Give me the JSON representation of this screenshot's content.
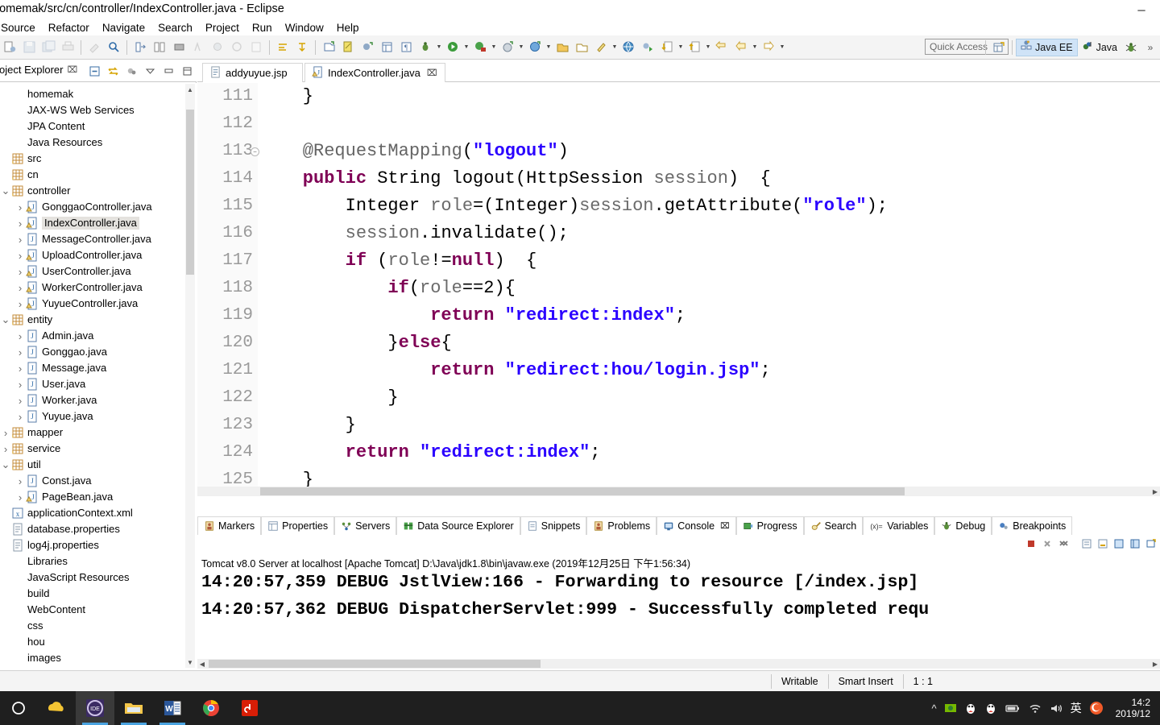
{
  "window": {
    "title": "homemak/src/cn/controller/IndexController.java - Eclipse",
    "minimize": "─",
    "maximize": "❐",
    "close": "✕"
  },
  "menubar": {
    "items": [
      "Source",
      "Refactor",
      "Navigate",
      "Search",
      "Project",
      "Run",
      "Window",
      "Help"
    ]
  },
  "toolbar": {
    "quick_access_placeholder": "Quick Access",
    "perspectives": [
      {
        "label": "Java EE",
        "active": true,
        "icon": "java-ee-perspective-icon"
      },
      {
        "label": "Java",
        "active": false,
        "icon": "java-perspective-icon"
      }
    ],
    "open_perspective_icon": "open-perspective-icon",
    "debug_perspective_icon": "debug-perspective-icon"
  },
  "explorer": {
    "tab_label": "Project Explorer",
    "tab_close": "⌧",
    "tools": [
      "collapse-all-icon",
      "link-with-editor-icon",
      "view-menu-icon",
      "minimize-icon",
      "maximize-icon"
    ],
    "tree": [
      {
        "label": "homemak",
        "indent": 0,
        "arrow": "",
        "icon": "project-icon",
        "selected": false
      },
      {
        "label": "JAX-WS Web Services",
        "indent": 0,
        "arrow": "",
        "icon": "folder-icon",
        "selected": false
      },
      {
        "label": "JPA Content",
        "indent": 0,
        "arrow": "",
        "icon": "folder-icon",
        "selected": false
      },
      {
        "label": "Java Resources",
        "indent": 0,
        "arrow": "",
        "icon": "folder-icon",
        "selected": false
      },
      {
        "label": "src",
        "indent": 0,
        "arrow": "",
        "icon": "source-folder-icon",
        "selected": false
      },
      {
        "label": "cn",
        "indent": 0,
        "arrow": "",
        "icon": "package-icon",
        "selected": false
      },
      {
        "label": "controller",
        "indent": 1,
        "arrow": "∨",
        "icon": "package-icon",
        "selected": false
      },
      {
        "label": "GonggaoController.java",
        "indent": 2,
        "arrow": "›",
        "icon": "java-warning-file-icon",
        "selected": false
      },
      {
        "label": "IndexController.java",
        "indent": 2,
        "arrow": "›",
        "icon": "java-warning-file-icon",
        "selected": true
      },
      {
        "label": "MessageController.java",
        "indent": 2,
        "arrow": "›",
        "icon": "java-file-icon",
        "selected": false
      },
      {
        "label": "UploadController.java",
        "indent": 2,
        "arrow": "›",
        "icon": "java-warning-file-icon",
        "selected": false
      },
      {
        "label": "UserController.java",
        "indent": 2,
        "arrow": "›",
        "icon": "java-warning-file-icon",
        "selected": false
      },
      {
        "label": "WorkerController.java",
        "indent": 2,
        "arrow": "›",
        "icon": "java-warning-file-icon",
        "selected": false
      },
      {
        "label": "YuyueController.java",
        "indent": 2,
        "arrow": "›",
        "icon": "java-warning-file-icon",
        "selected": false
      },
      {
        "label": "entity",
        "indent": 1,
        "arrow": "∨",
        "icon": "package-icon",
        "selected": false
      },
      {
        "label": "Admin.java",
        "indent": 2,
        "arrow": "›",
        "icon": "java-file-icon",
        "selected": false
      },
      {
        "label": "Gonggao.java",
        "indent": 2,
        "arrow": "›",
        "icon": "java-file-icon",
        "selected": false
      },
      {
        "label": "Message.java",
        "indent": 2,
        "arrow": "›",
        "icon": "java-file-icon",
        "selected": false
      },
      {
        "label": "User.java",
        "indent": 2,
        "arrow": "›",
        "icon": "java-file-icon",
        "selected": false
      },
      {
        "label": "Worker.java",
        "indent": 2,
        "arrow": "›",
        "icon": "java-file-icon",
        "selected": false
      },
      {
        "label": "Yuyue.java",
        "indent": 2,
        "arrow": "›",
        "icon": "java-file-icon",
        "selected": false
      },
      {
        "label": "mapper",
        "indent": 1,
        "arrow": "›",
        "icon": "package-icon",
        "selected": false
      },
      {
        "label": "service",
        "indent": 1,
        "arrow": "›",
        "icon": "package-icon",
        "selected": false
      },
      {
        "label": "util",
        "indent": 1,
        "arrow": "∨",
        "icon": "package-icon",
        "selected": false
      },
      {
        "label": "Const.java",
        "indent": 2,
        "arrow": "›",
        "icon": "java-file-icon",
        "selected": false
      },
      {
        "label": "PageBean.java",
        "indent": 2,
        "arrow": "›",
        "icon": "java-warning-file-icon",
        "selected": false
      },
      {
        "label": "applicationContext.xml",
        "indent": 0,
        "arrow": "",
        "icon": "xml-file-icon",
        "selected": false
      },
      {
        "label": "database.properties",
        "indent": 0,
        "arrow": "",
        "icon": "properties-file-icon",
        "selected": false
      },
      {
        "label": "log4j.properties",
        "indent": 0,
        "arrow": "",
        "icon": "properties-file-icon",
        "selected": false
      },
      {
        "label": "Libraries",
        "indent": 0,
        "arrow": "",
        "icon": "library-icon",
        "selected": false
      },
      {
        "label": "JavaScript Resources",
        "indent": 0,
        "arrow": "",
        "icon": "library-icon",
        "selected": false
      },
      {
        "label": "build",
        "indent": 0,
        "arrow": "",
        "icon": "folder-icon",
        "selected": false
      },
      {
        "label": "WebContent",
        "indent": 0,
        "arrow": "",
        "icon": "folder-icon",
        "selected": false
      },
      {
        "label": "css",
        "indent": 0,
        "arrow": "",
        "icon": "folder-icon",
        "selected": false
      },
      {
        "label": "hou",
        "indent": 0,
        "arrow": "",
        "icon": "folder-icon",
        "selected": false
      },
      {
        "label": "images",
        "indent": 0,
        "arrow": "",
        "icon": "folder-icon",
        "selected": false
      }
    ]
  },
  "editor": {
    "tabs": [
      {
        "label": "addyuyue.jsp",
        "active": false,
        "icon": "jsp-file-icon",
        "close": ""
      },
      {
        "label": "IndexController.java",
        "active": true,
        "icon": "java-warning-file-icon",
        "close": "⌧"
      }
    ],
    "first_line_number": 111,
    "lines": [
      {
        "num": "111",
        "fold": false,
        "tokens": [
          {
            "t": "p",
            "v": "    }"
          }
        ]
      },
      {
        "num": "112",
        "fold": false,
        "tokens": [
          {
            "t": "p",
            "v": ""
          }
        ]
      },
      {
        "num": "113",
        "fold": true,
        "tokens": [
          {
            "t": "a",
            "v": "    @RequestMapping"
          },
          {
            "t": "p",
            "v": "("
          },
          {
            "t": "s",
            "v": "\"logout\""
          },
          {
            "t": "p",
            "v": ")"
          }
        ]
      },
      {
        "num": "114",
        "fold": false,
        "tokens": [
          {
            "t": "k",
            "v": "    public"
          },
          {
            "t": "p",
            "v": " String logout(HttpSession "
          },
          {
            "t": "f",
            "v": "session"
          },
          {
            "t": "p",
            "v": ")  {"
          }
        ]
      },
      {
        "num": "115",
        "fold": false,
        "tokens": [
          {
            "t": "p",
            "v": "        Integer "
          },
          {
            "t": "f",
            "v": "role"
          },
          {
            "t": "p",
            "v": "=(Integer)"
          },
          {
            "t": "f",
            "v": "session"
          },
          {
            "t": "p",
            "v": ".getAttribute("
          },
          {
            "t": "s",
            "v": "\"role\""
          },
          {
            "t": "p",
            "v": ");"
          }
        ]
      },
      {
        "num": "116",
        "fold": false,
        "tokens": [
          {
            "t": "p",
            "v": "        "
          },
          {
            "t": "f",
            "v": "session"
          },
          {
            "t": "p",
            "v": ".invalidate();"
          }
        ]
      },
      {
        "num": "117",
        "fold": false,
        "tokens": [
          {
            "t": "k",
            "v": "        if"
          },
          {
            "t": "p",
            "v": " ("
          },
          {
            "t": "f",
            "v": "role"
          },
          {
            "t": "p",
            "v": "!="
          },
          {
            "t": "k",
            "v": "null"
          },
          {
            "t": "p",
            "v": ")  {"
          }
        ]
      },
      {
        "num": "118",
        "fold": false,
        "tokens": [
          {
            "t": "k",
            "v": "            if"
          },
          {
            "t": "p",
            "v": "("
          },
          {
            "t": "f",
            "v": "role"
          },
          {
            "t": "p",
            "v": "==2){"
          }
        ]
      },
      {
        "num": "119",
        "fold": false,
        "tokens": [
          {
            "t": "k",
            "v": "                return"
          },
          {
            "t": "p",
            "v": " "
          },
          {
            "t": "s",
            "v": "\"redirect:index\""
          },
          {
            "t": "p",
            "v": ";"
          }
        ]
      },
      {
        "num": "120",
        "fold": false,
        "tokens": [
          {
            "t": "p",
            "v": "            }"
          },
          {
            "t": "k",
            "v": "else"
          },
          {
            "t": "p",
            "v": "{"
          }
        ]
      },
      {
        "num": "121",
        "fold": false,
        "tokens": [
          {
            "t": "k",
            "v": "                return"
          },
          {
            "t": "p",
            "v": " "
          },
          {
            "t": "s",
            "v": "\"redirect:hou/login.jsp\""
          },
          {
            "t": "p",
            "v": ";"
          }
        ]
      },
      {
        "num": "122",
        "fold": false,
        "tokens": [
          {
            "t": "p",
            "v": "            }"
          }
        ]
      },
      {
        "num": "123",
        "fold": false,
        "tokens": [
          {
            "t": "p",
            "v": "        }"
          }
        ]
      },
      {
        "num": "124",
        "fold": false,
        "tokens": [
          {
            "t": "k",
            "v": "        return"
          },
          {
            "t": "p",
            "v": " "
          },
          {
            "t": "s",
            "v": "\"redirect:index\""
          },
          {
            "t": "p",
            "v": ";"
          }
        ]
      },
      {
        "num": "125",
        "fold": false,
        "tokens": [
          {
            "t": "p",
            "v": "    }"
          }
        ]
      }
    ]
  },
  "bottom_panel": {
    "tabs": [
      {
        "label": "Markers",
        "icon": "markers-icon",
        "active": false,
        "close": ""
      },
      {
        "label": "Properties",
        "icon": "properties-icon",
        "active": false,
        "close": ""
      },
      {
        "label": "Servers",
        "icon": "servers-icon",
        "active": false,
        "close": ""
      },
      {
        "label": "Data Source Explorer",
        "icon": "data-source-explorer-icon",
        "active": false,
        "close": ""
      },
      {
        "label": "Snippets",
        "icon": "snippets-icon",
        "active": false,
        "close": ""
      },
      {
        "label": "Problems",
        "icon": "problems-icon",
        "active": false,
        "close": ""
      },
      {
        "label": "Console",
        "icon": "console-icon",
        "active": true,
        "close": "⌧"
      },
      {
        "label": "Progress",
        "icon": "progress-icon",
        "active": false,
        "close": ""
      },
      {
        "label": "Search",
        "icon": "search-icon",
        "active": false,
        "close": ""
      },
      {
        "label": "Variables",
        "icon": "variables-icon",
        "active": false,
        "close": ""
      },
      {
        "label": "Debug",
        "icon": "debug-icon",
        "active": false,
        "close": ""
      },
      {
        "label": "Breakpoints",
        "icon": "breakpoints-icon",
        "active": false,
        "close": ""
      }
    ],
    "console_header": "Tomcat v8.0 Server at localhost [Apache Tomcat] D:\\Java\\jdk1.8\\bin\\javaw.exe (2019年12月25日 下午1:56:34)",
    "console_lines": [
      "14:20:57,359 DEBUG JstlView:166 - Forwarding to resource [/index.jsp]",
      "14:20:57,362 DEBUG DispatcherServlet:999 - Successfully completed requ"
    ]
  },
  "statusbar": {
    "writable": "Writable",
    "insert_mode": "Smart Insert",
    "position": "1 : 1"
  },
  "taskbar": {
    "start_icon": "start-circle-icon",
    "apps": [
      {
        "name": "baidu-netdisk-icon",
        "active": false
      },
      {
        "name": "eclipse-ide-icon",
        "active": true
      },
      {
        "name": "file-explorer-icon",
        "active": false
      },
      {
        "name": "word-icon",
        "active": false
      },
      {
        "name": "chrome-icon",
        "active": false
      },
      {
        "name": "netease-music-icon",
        "active": false
      }
    ],
    "tray": [
      "show-hidden-icons-chevron",
      "nvidia-icon",
      "qq-icon",
      "qq-icon-2",
      "battery-icon",
      "wifi-icon",
      "volume-icon",
      "ime-chinese-icon",
      "sogou-input-icon"
    ],
    "ime_label": "英",
    "clock_time": "14:2",
    "clock_date": "2019/12"
  }
}
